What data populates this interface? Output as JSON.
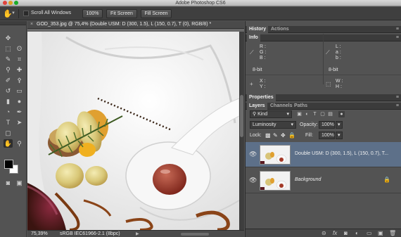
{
  "window": {
    "title": "Adobe Photoshop CS6"
  },
  "options_bar": {
    "tool_icon": "hand-icon",
    "scroll_all_windows_label": "Scroll All Windows",
    "scroll_all_windows_checked": false,
    "zoom_100_label": "100%",
    "fit_screen_label": "Fit Screen",
    "fill_screen_label": "Fill Screen"
  },
  "document": {
    "tab_title": "GOD_353.jpg @ 75,4% (Double USM: D (300, 1.5), L (150, 0.7), T (0), RGB/8) *",
    "close_glyph": "×"
  },
  "status_bar": {
    "zoom": "75,39%",
    "profile": "sRGB IEC61966-2.1 (8bpc)",
    "arrow_glyph": "▶"
  },
  "panels": {
    "top_tabs": [
      "History",
      "Actions"
    ],
    "info": {
      "title": "Info",
      "rgb_labels": [
        "R :",
        "G :",
        "B :"
      ],
      "lab_labels": [
        "L :",
        "a :",
        "b :"
      ],
      "bit_depth_left": "8-bit",
      "bit_depth_right": "8-bit",
      "xy_labels": [
        "X :",
        "Y :"
      ],
      "wh_labels": [
        "W :",
        "H :"
      ]
    },
    "properties_title": "Properties",
    "layer_tabs": [
      "Layers",
      "Channels",
      "Paths"
    ],
    "kind_filter": "Kind",
    "blend_mode": "Luminosity",
    "opacity_label": "Opacity:",
    "opacity_value": "100%",
    "lock_label": "Lock:",
    "fill_label": "Fill:",
    "fill_value": "100%",
    "layers": [
      {
        "name": "Double USM: D (300, 1.5), L (150, 0.7), T...",
        "selected": true,
        "locked": false,
        "italic": false
      },
      {
        "name": "Background",
        "selected": false,
        "locked": true,
        "italic": true
      }
    ],
    "footer_icons": [
      "link-icon",
      "fx-icon",
      "mask-icon",
      "adjustment-icon",
      "group-icon",
      "new-layer-icon",
      "trash-icon"
    ],
    "footer_glyphs": [
      "⊝",
      "fx",
      "◙",
      "◐",
      "▭",
      "▣",
      "🗑"
    ]
  },
  "colors": {
    "selected_layer": "#5d7089",
    "panel_bg": "#535353",
    "foreground": "#000000",
    "background": "#ffffff"
  }
}
